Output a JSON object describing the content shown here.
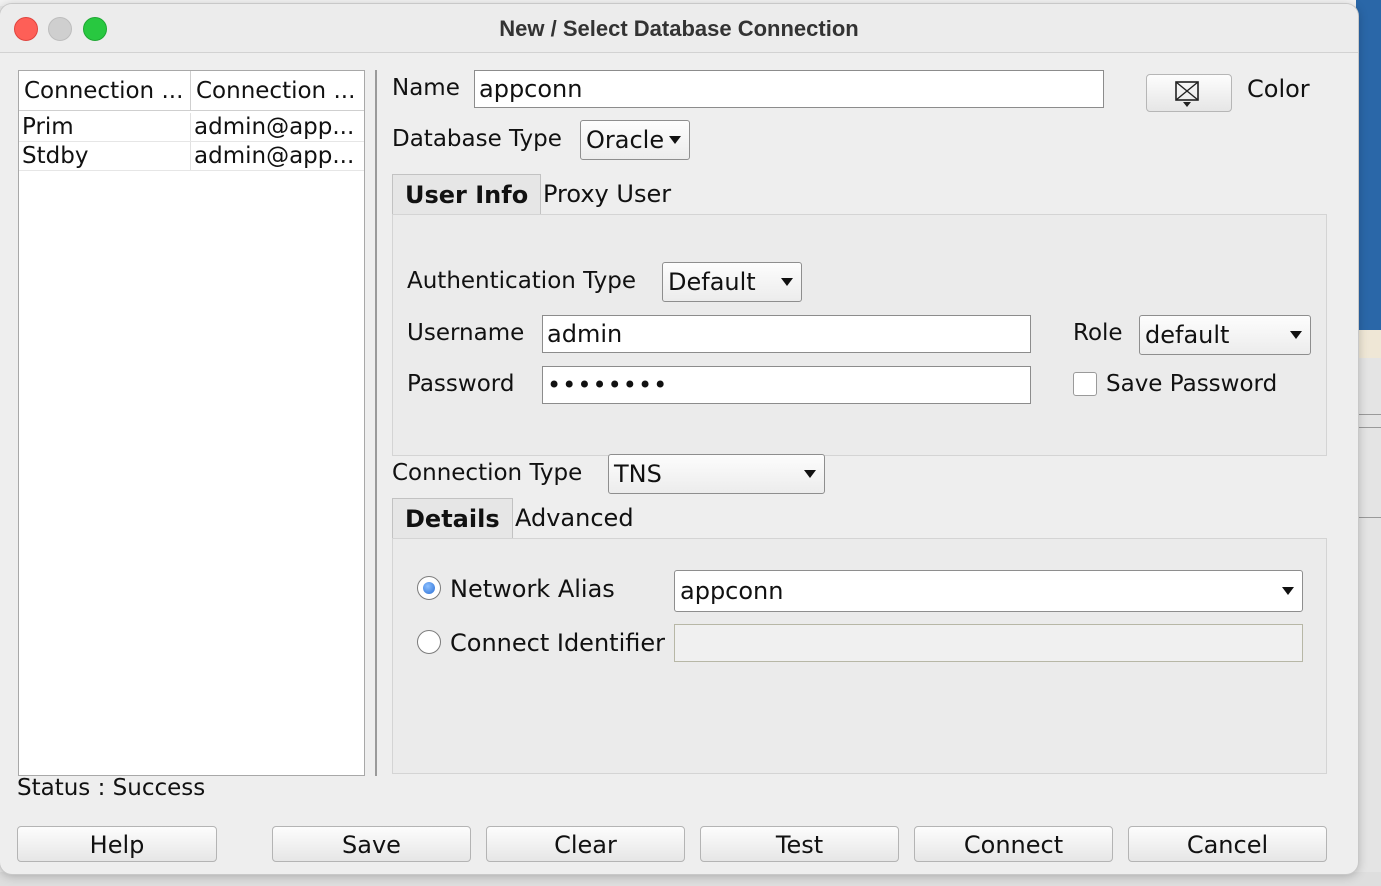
{
  "window": {
    "title": "New / Select Database Connection"
  },
  "connections": {
    "headers": [
      "Connection ...",
      "Connection ..."
    ],
    "rows": [
      {
        "name": "Prim",
        "details": "admin@app..."
      },
      {
        "name": "Stdby",
        "details": "admin@app..."
      }
    ]
  },
  "form": {
    "name_label": "Name",
    "name_value": "appconn",
    "color_label": "Color",
    "db_type_label": "Database Type",
    "db_type_value": "Oracle",
    "tabs": {
      "user_info": "User Info",
      "proxy_user": "Proxy User"
    },
    "auth_type_label": "Authentication Type",
    "auth_type_value": "Default",
    "username_label": "Username",
    "username_value": "admin",
    "role_label": "Role",
    "role_value": "default",
    "password_label": "Password",
    "password_value": "••••••••",
    "save_password_label": "Save Password",
    "save_password_checked": false,
    "conn_type_label": "Connection Type",
    "conn_type_value": "TNS",
    "conn_tabs": {
      "details": "Details",
      "advanced": "Advanced"
    },
    "network_alias_label": "Network Alias",
    "network_alias_value": "appconn",
    "network_alias_selected": true,
    "connect_identifier_label": "Connect Identifier",
    "connect_identifier_value": ""
  },
  "status": {
    "text": "Status : Success"
  },
  "buttons": {
    "help": "Help",
    "save": "Save",
    "clear": "Clear",
    "test": "Test",
    "connect": "Connect",
    "cancel": "Cancel"
  },
  "colors": {
    "close": "#fe5f57",
    "maximize": "#28c840",
    "radio_selected": "#2b6fd6",
    "background_window": "#2a67a8"
  },
  "icons": {
    "color_button": "no-color-swatch-icon"
  }
}
